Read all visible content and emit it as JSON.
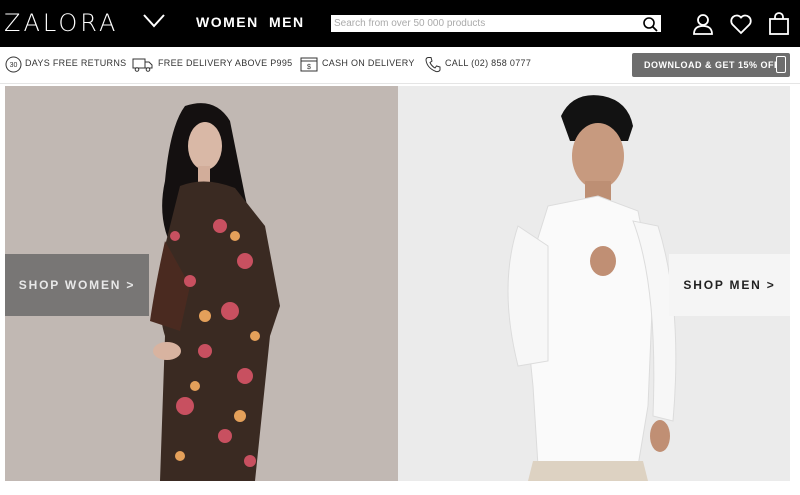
{
  "header": {
    "logo": "ZALORA",
    "nav": [
      "WOMEN",
      "MEN"
    ],
    "search_placeholder": "Search from over 50 000 products"
  },
  "usps": [
    {
      "icon": "30-days-returns-icon",
      "text": "DAYS FREE RETURNS",
      "badge": "30"
    },
    {
      "icon": "delivery-truck-icon",
      "text": "FREE DELIVERY ABOVE P995"
    },
    {
      "icon": "cash-icon",
      "text": "CASH ON DELIVERY",
      "badge": "$"
    },
    {
      "icon": "phone-icon",
      "text": "CALL (02) 858 0777"
    }
  ],
  "download_banner": "DOWNLOAD & GET 15% OFF",
  "hero": {
    "shop_women": "SHOP WOMEN >",
    "shop_men": "SHOP MEN >"
  },
  "colors": {
    "header_bg": "#000000",
    "banner_bg": "#6d6d6d"
  }
}
